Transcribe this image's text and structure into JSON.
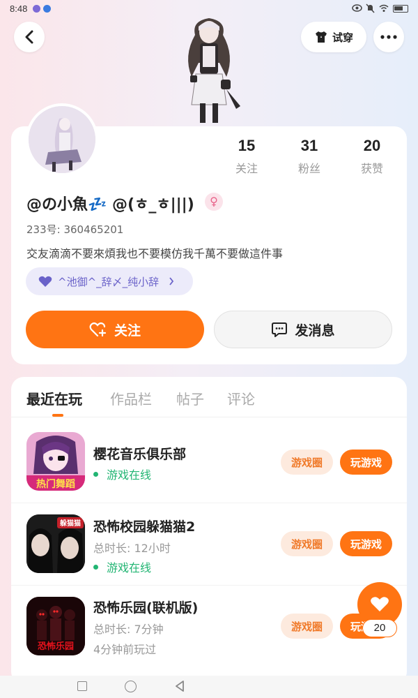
{
  "status_bar": {
    "time": "8:48"
  },
  "header": {
    "tryon_label": "试穿"
  },
  "profile": {
    "stats": [
      {
        "value": "15",
        "label": "关注"
      },
      {
        "value": "31",
        "label": "粉丝"
      },
      {
        "value": "20",
        "label": "获赞"
      }
    ],
    "name": "@の小魚💤 @(ㅎ_ㅎ|||)",
    "id_line": "233号: 360465201",
    "bio": "交友滴滴不要來煩我也不要模仿我千萬不要做這件事",
    "group": "^池御^_辞〆_纯小辞",
    "follow_label": "关注",
    "message_label": "发消息"
  },
  "tabs": [
    "最近在玩",
    "作品栏",
    "帖子",
    "评论"
  ],
  "games": [
    {
      "title": "樱花音乐俱乐部",
      "playtime": "",
      "last_played": "",
      "online": "游戏在线",
      "icon_text": "热门舞蹈",
      "circle_label": "游戏圈",
      "play_label": "玩游戏"
    },
    {
      "title": "恐怖校园躲猫猫2",
      "playtime": "总时长: 12小时",
      "last_played": "",
      "online": "游戏在线",
      "icon_text": "躲猫猫",
      "circle_label": "游戏圈",
      "play_label": "玩游戏"
    },
    {
      "title": "恐怖乐园(联机版)",
      "playtime": "总时长: 7分钟",
      "last_played": "4分钟前玩过",
      "online": "",
      "icon_text": "恐怖乐园",
      "circle_label": "游戏圈",
      "play_label": "玩游戏"
    }
  ],
  "like_fab": {
    "count": "20"
  },
  "colors": {
    "accent": "#ff7413",
    "online": "#22b573",
    "group": "#6a62c9"
  }
}
